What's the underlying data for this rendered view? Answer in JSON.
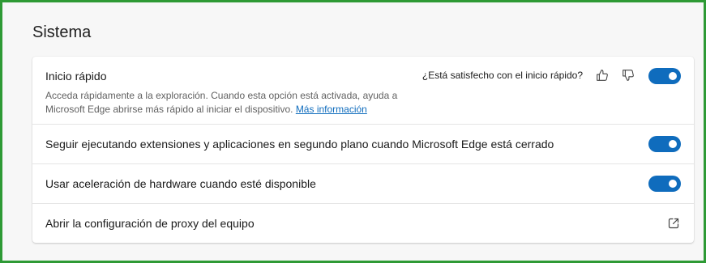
{
  "section": {
    "title": "Sistema"
  },
  "settings": [
    {
      "title": "Inicio rápido",
      "description": "Acceda rápidamente a la exploración. Cuando esta opción está activada, ayuda a Microsoft Edge abrirse más rápido al iniciar el dispositivo.",
      "link_label": "Más información",
      "feedback_question": "¿Está satisfecho con el inicio rápido?",
      "feedback_icons": [
        "thumbs-up-icon",
        "thumbs-down-icon"
      ],
      "toggle_on": true
    },
    {
      "title": "Seguir ejecutando extensiones y aplicaciones en segundo plano cuando Microsoft Edge está cerrado",
      "toggle_on": true
    },
    {
      "title": "Usar aceleración de hardware cuando esté disponible",
      "toggle_on": true
    },
    {
      "title": "Abrir la configuración de proxy del equipo",
      "action_icon": "external-link-icon"
    }
  ],
  "colors": {
    "accent": "#0f6cbd",
    "frame_border": "#2e9a35",
    "page_background": "#f7f7f7",
    "card_background": "#ffffff"
  }
}
